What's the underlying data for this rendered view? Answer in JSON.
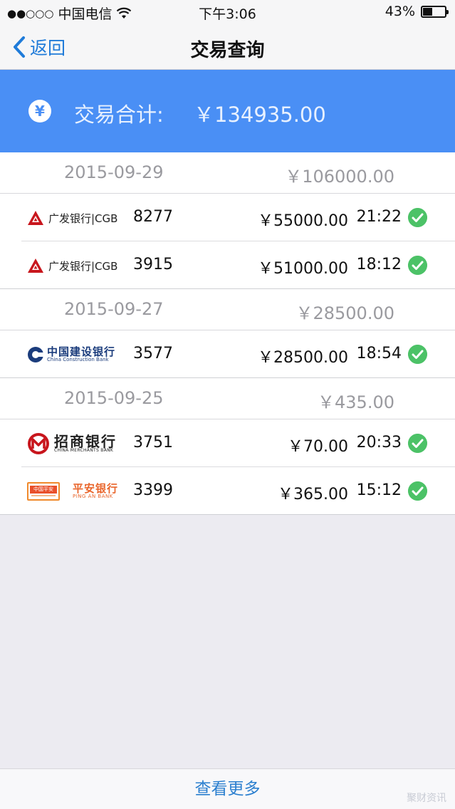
{
  "status_bar": {
    "signal_dots": "●●○○○",
    "carrier": "中国电信",
    "time": "下午3:06",
    "battery_pct_text": "43%",
    "battery_level": 0.43
  },
  "nav": {
    "back_label": "返回",
    "title": "交易查询"
  },
  "summary": {
    "icon_glyph": "¥",
    "label": "交易合计:",
    "total": "￥134935.00"
  },
  "groups": [
    {
      "date": "2015-09-29",
      "subtotal": "￥106000.00",
      "transactions": [
        {
          "bank": "广发银行|CGB",
          "card": "8277",
          "amount": "￥55000.00",
          "time": "21:22"
        },
        {
          "bank": "广发银行|CGB",
          "card": "3915",
          "amount": "￥51000.00",
          "time": "18:12"
        }
      ]
    },
    {
      "date": "2015-09-27",
      "subtotal": "￥28500.00",
      "transactions": [
        {
          "bank": "中国建设银行",
          "bank_en": "China Construction Bank",
          "card": "3577",
          "amount": "￥28500.00",
          "time": "18:54"
        }
      ]
    },
    {
      "date": "2015-09-25",
      "subtotal": "￥435.00",
      "transactions": [
        {
          "bank": "招商银行",
          "bank_en": "CHINA MERCHANTS BANK",
          "card": "3751",
          "amount": "￥70.00",
          "time": "20:33"
        },
        {
          "bank": "平安银行",
          "bank_en": "PING AN BANK",
          "bank_badge": "中国平安",
          "card": "3399",
          "amount": "￥365.00",
          "time": "15:12"
        }
      ]
    }
  ],
  "footer": {
    "more_label": "查看更多",
    "watermark": "聚财资讯"
  },
  "colors": {
    "accent_blue": "#4a8ff5",
    "link_blue": "#1f7bd9",
    "success_green": "#4cc267",
    "cgb_red": "#c8161d",
    "ccb_blue": "#1b3c7c",
    "cmb_red": "#c8161d",
    "pingan_orange": "#e9652b"
  }
}
